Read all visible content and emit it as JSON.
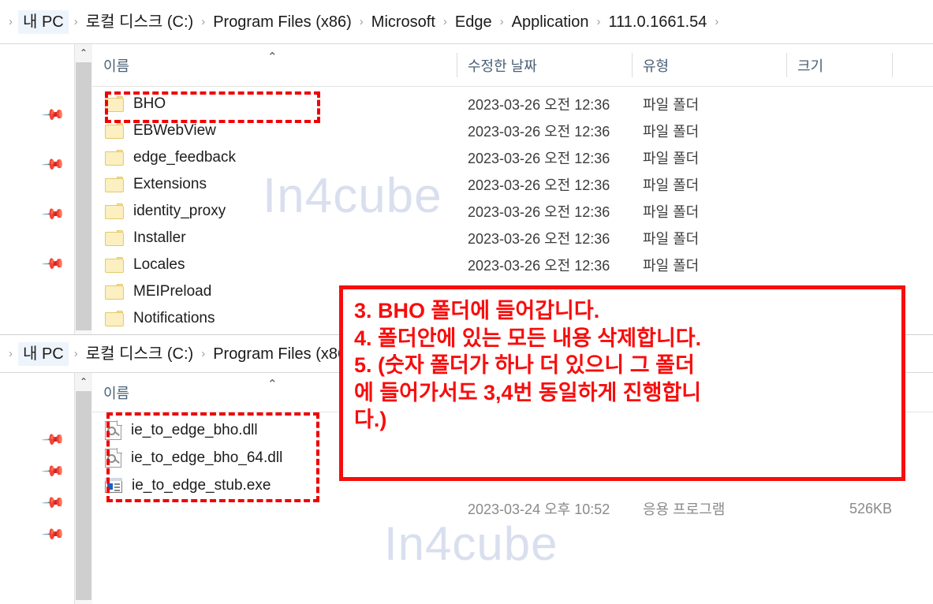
{
  "window_top": {
    "breadcrumb": {
      "name": "address-bar",
      "separator": "›",
      "leading_separator": "›",
      "trailing_separator": "›",
      "items": [
        "내 PC",
        "로컬 디스크 (C:)",
        "Program Files (x86)",
        "Microsoft",
        "Edge",
        "Application",
        "111.0.1661.54"
      ]
    },
    "columns": [
      {
        "label": "이름",
        "key": "name"
      },
      {
        "label": "수정한 날짜",
        "key": "date"
      },
      {
        "label": "유형",
        "key": "type"
      },
      {
        "label": "크기",
        "key": "size"
      }
    ],
    "sort_indicator": "⌃",
    "scroll_up_glyph": "⌃",
    "pin_glyph": "📌",
    "pin_count": 4,
    "rows": [
      {
        "name": "BHO",
        "icon": "folder-icon",
        "date": "2023-03-26 오전 12:36",
        "type": "파일 폴더",
        "size": ""
      },
      {
        "name": "EBWebView",
        "icon": "folder-icon",
        "date": "2023-03-26 오전 12:36",
        "type": "파일 폴더",
        "size": ""
      },
      {
        "name": "edge_feedback",
        "icon": "folder-icon",
        "date": "2023-03-26 오전 12:36",
        "type": "파일 폴더",
        "size": ""
      },
      {
        "name": "Extensions",
        "icon": "folder-icon",
        "date": "2023-03-26 오전 12:36",
        "type": "파일 폴더",
        "size": ""
      },
      {
        "name": "identity_proxy",
        "icon": "folder-icon",
        "date": "2023-03-26 오전 12:36",
        "type": "파일 폴더",
        "size": ""
      },
      {
        "name": "Installer",
        "icon": "folder-icon",
        "date": "2023-03-26 오전 12:36",
        "type": "파일 폴더",
        "size": ""
      },
      {
        "name": "Locales",
        "icon": "folder-icon",
        "date": "2023-03-26 오전 12:36",
        "type": "파일 폴더",
        "size": ""
      },
      {
        "name": "MEIPreload",
        "icon": "folder-icon",
        "date": "",
        "type": "",
        "size": ""
      },
      {
        "name": "Notifications",
        "icon": "folder-icon",
        "date": "",
        "type": "",
        "size": ""
      }
    ],
    "watermark": "In4cube"
  },
  "window_bottom": {
    "breadcrumb": {
      "name": "address-bar",
      "separator": "›",
      "leading_separator": "›",
      "items": [
        "내 PC",
        "로컬 디스크 (C:)",
        "Program Files (x86"
      ]
    },
    "columns": [
      {
        "label": "이름",
        "key": "name"
      }
    ],
    "sort_indicator": "⌃",
    "scroll_up_glyph": "⌃",
    "pin_glyph": "📌",
    "pin_count": 4,
    "rows": [
      {
        "name": "ie_to_edge_bho.dll",
        "icon": "dll-file-icon",
        "date": "",
        "type": "",
        "size": ""
      },
      {
        "name": "ie_to_edge_bho_64.dll",
        "icon": "dll-file-icon",
        "date": "",
        "type": "",
        "size": ""
      },
      {
        "name": "ie_to_edge_stub.exe",
        "icon": "exe-file-icon",
        "date": "",
        "type": "",
        "size": ""
      }
    ],
    "partial_row": {
      "date": "2023-03-24 오후 10:52",
      "type": "응용 프로그램",
      "size": "526KB"
    },
    "watermark": "In4cube"
  },
  "annotation": {
    "name": "instruction-callout",
    "text": "3. BHO 폴더에 들어갑니다.\n4. 폴더안에 있는 모든 내용 삭제합니다.\n5. (숫자 폴더가 하나 더 있으니 그 폴더\n에 들어가서도 3,4번 동일하게 진행합니\n다.)"
  },
  "highlights": {
    "top_box_target": "BHO",
    "bottom_box_target": "ie_to_edge files"
  },
  "colors": {
    "annotation_red": "#f70d0d",
    "dashed_red": "#f00000",
    "folder_yellow": "#fcefc0",
    "header_text": "#4a6076",
    "watermark": "#d9dfee"
  }
}
